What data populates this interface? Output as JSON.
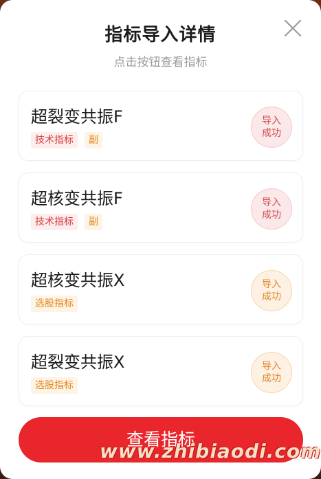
{
  "dialog": {
    "title": "指标导入详情",
    "subtitle": "点击按钮查看指标",
    "close_icon": "close-icon"
  },
  "cards": [
    {
      "name": "超裂变共振F",
      "tags": [
        {
          "label": "技术指标",
          "color": "red"
        },
        {
          "label": "副",
          "color": "orange"
        }
      ],
      "status": "导入\n成功",
      "status_color": "red"
    },
    {
      "name": "超核变共振F",
      "tags": [
        {
          "label": "技术指标",
          "color": "red"
        },
        {
          "label": "副",
          "color": "orange"
        }
      ],
      "status": "导入\n成功",
      "status_color": "red"
    },
    {
      "name": "超核变共振X",
      "tags": [
        {
          "label": "选股指标",
          "color": "orange"
        }
      ],
      "status": "导入\n成功",
      "status_color": "orange"
    },
    {
      "name": "超裂变共振X",
      "tags": [
        {
          "label": "选股指标",
          "color": "orange"
        }
      ],
      "status": "导入\n成功",
      "status_color": "orange"
    }
  ],
  "cta": {
    "label": "查看指标",
    "color": "#e8262b"
  },
  "watermark": "www.zhibiaodi.com"
}
